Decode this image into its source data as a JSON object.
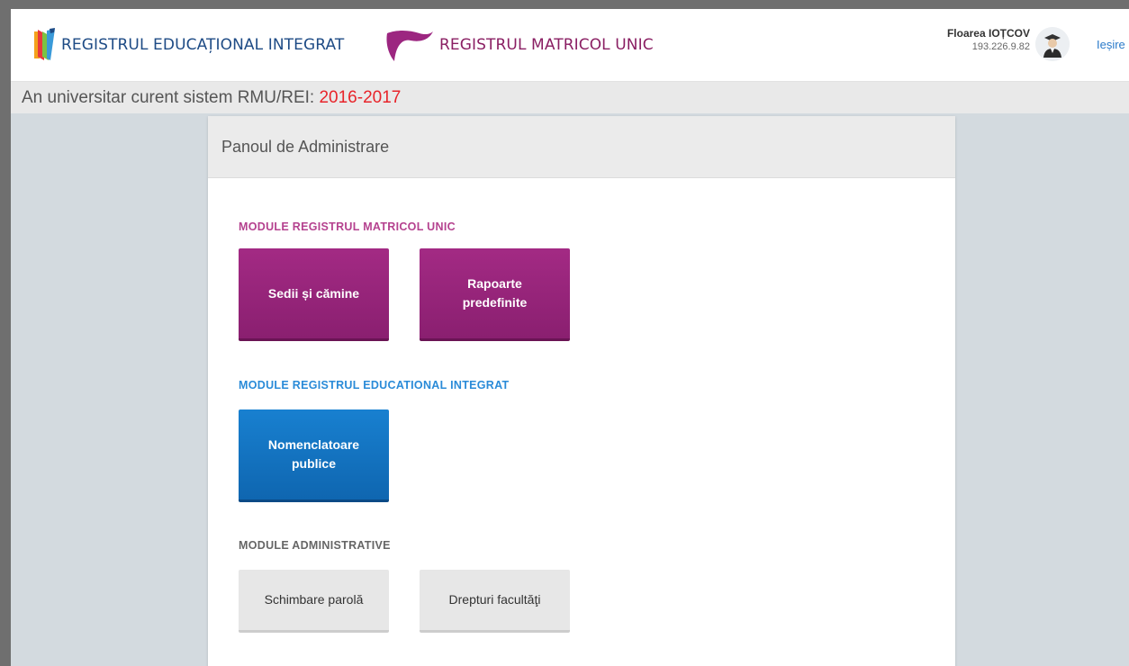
{
  "header": {
    "rei_logo_text": "REGISTRUL EDUCAȚIONAL INTEGRAT",
    "rmu_logo_text": "REGISTRUL MATRICOL UNIC",
    "user_name": "Floarea IOȚCOV",
    "user_ip": "193.226.9.82",
    "logout_label": "Ieșire"
  },
  "yearbar": {
    "label": "An universitar curent sistem RMU/REI:",
    "year": "2016-2017"
  },
  "panel": {
    "title": "Panoul de Administrare",
    "sections": [
      {
        "title": "MODULE REGISTRUL MATRICOL UNIC",
        "color": "#b5428f",
        "tiles": [
          "Sedii și cămine",
          "Rapoarte predefinite"
        ]
      },
      {
        "title": "MODULE REGISTRUL EDUCATIONAL INTEGRAT",
        "color": "#2a8bd8",
        "tiles": [
          "Nomenclatoare publice"
        ]
      },
      {
        "title": "MODULE ADMINISTRATIVE",
        "color": "#666666",
        "tiles": [
          "Schimbare parolă",
          "Drepturi facultăţi"
        ]
      }
    ]
  },
  "colors": {
    "rmu_purple": "#9c2680",
    "rei_blue": "#1474c4",
    "year_red": "#e8242a"
  }
}
